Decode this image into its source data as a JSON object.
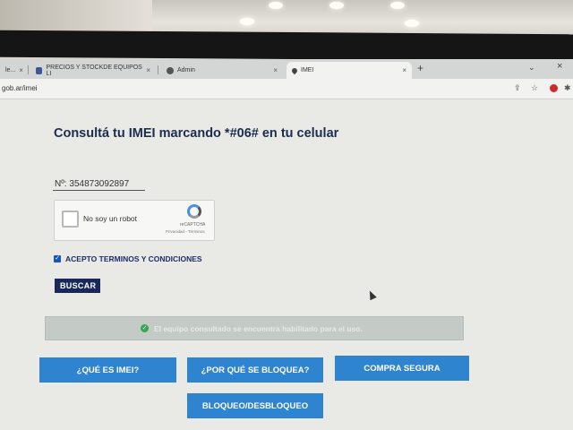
{
  "browser": {
    "tabs": [
      {
        "label": "le...",
        "active": false
      },
      {
        "label": "PRECIOS Y STOCKDE EQUIPOS LI",
        "active": false
      },
      {
        "label": "Admin",
        "active": false
      },
      {
        "label": "IMEI",
        "active": true
      }
    ],
    "url": "gob.ar/imei"
  },
  "page": {
    "heading": "Consultá tu IMEI marcando *#06# en tu celular",
    "imei_input": {
      "value": "Nº: 354873092897"
    },
    "captcha": {
      "label": "No soy un robot",
      "brand": "reCAPTCHA",
      "links": "Privacidad - Términos"
    },
    "terms": {
      "checked": true,
      "label": "ACEPTO TERMINOS Y CONDICIONES"
    },
    "search_button": "BUSCAR",
    "result_message": "El equipo consultado se encuentra habilitado para el uso.",
    "buttons": [
      "¿QUÉ ES IMEI?",
      "¿POR QUÉ SE BLOQUEA?",
      "COMPRA SEGURA",
      "BLOQUEO/DESBLOQUEO"
    ]
  },
  "colors": {
    "primary_button": "#2f84cf",
    "dark_button": "#19285a",
    "success": "#2fa84f",
    "heading": "#1c2d4f"
  }
}
